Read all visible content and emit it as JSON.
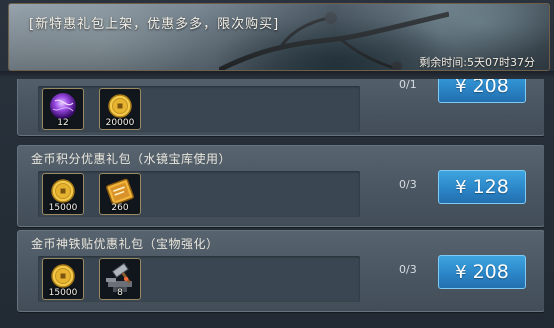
{
  "banner": {
    "title": "[新特惠礼包上架，优惠多多，限次购买]",
    "timer": "剩余时间:5天07时37分"
  },
  "packs": [
    {
      "title": "",
      "items": [
        {
          "icon": "purple-orb-icon",
          "qty": "12"
        },
        {
          "icon": "gold-coin-icon",
          "qty": "20000"
        }
      ],
      "limit": "0/1",
      "currency": "¥",
      "price": "208"
    },
    {
      "title": "金币积分优惠礼包（水镜宝库使用）",
      "items": [
        {
          "icon": "gold-coin-icon",
          "qty": "15000"
        },
        {
          "icon": "gold-ticket-icon",
          "qty": "260"
        }
      ],
      "limit": "0/3",
      "currency": "¥",
      "price": "128"
    },
    {
      "title": "金币神铁贴优惠礼包（宝物强化）",
      "items": [
        {
          "icon": "gold-coin-icon",
          "qty": "15000"
        },
        {
          "icon": "anvil-hammer-icon",
          "qty": "8"
        }
      ],
      "limit": "0/3",
      "currency": "¥",
      "price": "208"
    }
  ]
}
